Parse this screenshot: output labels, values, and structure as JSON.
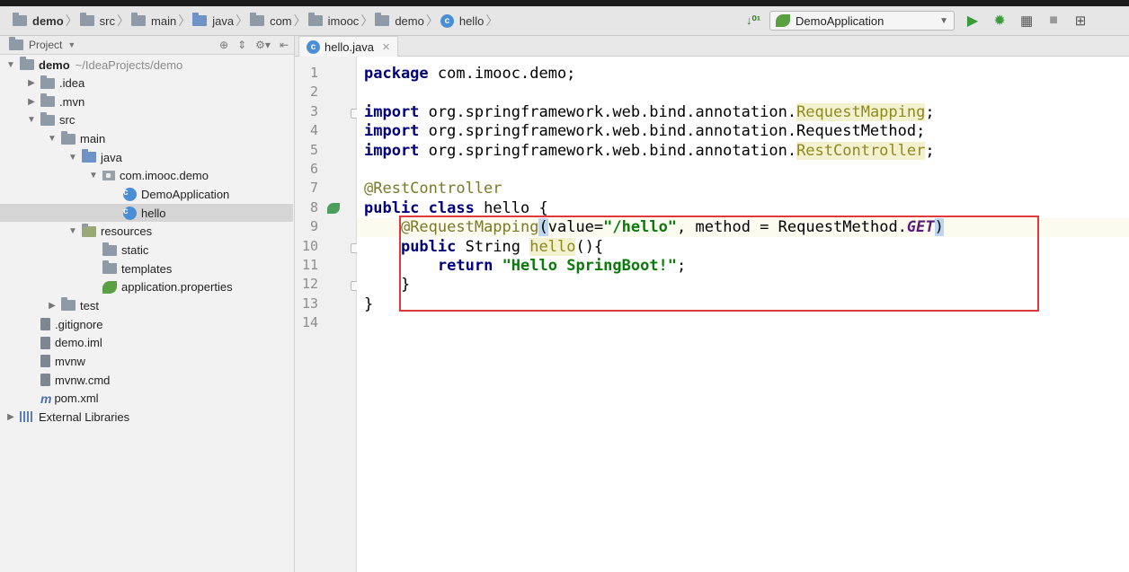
{
  "breadcrumb": [
    "demo",
    "src",
    "main",
    "java",
    "com",
    "imooc",
    "demo",
    "hello"
  ],
  "run_config": {
    "selected": "DemoApplication"
  },
  "project_panel": {
    "title": "Project",
    "tree": [
      {
        "label": "demo",
        "suffix": "~/IdeaProjects/demo",
        "icon": "module-folder-icon",
        "level": 0,
        "expanded": true
      },
      {
        "label": ".idea",
        "icon": "folder-icon",
        "level": 1,
        "expanded": false
      },
      {
        "label": ".mvn",
        "icon": "folder-icon",
        "level": 1,
        "expanded": false
      },
      {
        "label": "src",
        "icon": "folder-icon",
        "level": 1,
        "expanded": true
      },
      {
        "label": "main",
        "icon": "folder-icon",
        "level": 2,
        "expanded": true
      },
      {
        "label": "java",
        "icon": "source-folder-icon",
        "level": 3,
        "expanded": true
      },
      {
        "label": "com.imooc.demo",
        "icon": "package-icon",
        "level": 4,
        "expanded": true
      },
      {
        "label": "DemoApplication",
        "icon": "spring-class-icon",
        "level": 5
      },
      {
        "label": "hello",
        "icon": "class-icon",
        "level": 5,
        "selected": true
      },
      {
        "label": "resources",
        "icon": "resources-folder-icon",
        "level": 3,
        "expanded": true
      },
      {
        "label": "static",
        "icon": "folder-icon",
        "level": 4
      },
      {
        "label": "templates",
        "icon": "folder-icon",
        "level": 4
      },
      {
        "label": "application.properties",
        "icon": "spring-properties-icon",
        "level": 4
      },
      {
        "label": "test",
        "icon": "folder-icon",
        "level": 2,
        "expanded": false
      },
      {
        "label": ".gitignore",
        "icon": "file-icon",
        "level": 1
      },
      {
        "label": "demo.iml",
        "icon": "file-icon",
        "level": 1
      },
      {
        "label": "mvnw",
        "icon": "file-icon",
        "level": 1
      },
      {
        "label": "mvnw.cmd",
        "icon": "file-icon",
        "level": 1
      },
      {
        "label": "pom.xml",
        "icon": "maven-icon",
        "level": 1
      },
      {
        "label": "External Libraries",
        "icon": "libraries-icon",
        "level": 0,
        "expanded": false
      }
    ]
  },
  "editor": {
    "tab": "hello.java",
    "line_numbers": [
      "1",
      "2",
      "3",
      "4",
      "5",
      "6",
      "7",
      "8",
      "9",
      "10",
      "11",
      "12",
      "13",
      "14"
    ],
    "code": [
      [
        {
          "t": "package",
          "c": "kw"
        },
        {
          "t": " com.imooc.demo;"
        }
      ],
      [],
      [
        {
          "t": "import",
          "c": "kw"
        },
        {
          "t": " org.springframework.web.bind.annotation."
        },
        {
          "t": "RequestMapping",
          "c": "unres"
        },
        {
          "t": ";"
        }
      ],
      [
        {
          "t": "import",
          "c": "kw"
        },
        {
          "t": " org.springframework.web.bind.annotation.RequestMethod;"
        }
      ],
      [
        {
          "t": "import",
          "c": "kw"
        },
        {
          "t": " org.springframework.web.bind.annotation."
        },
        {
          "t": "RestController",
          "c": "unres"
        },
        {
          "t": ";"
        }
      ],
      [],
      [
        {
          "t": "@RestController",
          "c": "ann"
        }
      ],
      [
        {
          "t": "public class",
          "c": "kw"
        },
        {
          "t": " hello {"
        }
      ],
      [
        {
          "t": "    "
        },
        {
          "t": "@RequestMapping",
          "c": "ann"
        },
        {
          "t": "(",
          "c": "paren"
        },
        {
          "t": "value="
        },
        {
          "t": "\"/hello\"",
          "c": "str"
        },
        {
          "t": ", method = RequestMethod."
        },
        {
          "t": "GET",
          "c": "fld"
        },
        {
          "t": ")",
          "c": "paren"
        }
      ],
      [
        {
          "t": "    "
        },
        {
          "t": "public",
          "c": "kw"
        },
        {
          "t": " String "
        },
        {
          "t": "hello",
          "c": "unres"
        },
        {
          "t": "(){"
        }
      ],
      [
        {
          "t": "        "
        },
        {
          "t": "return",
          "c": "kw"
        },
        {
          "t": " "
        },
        {
          "t": "\"Hello SpringBoot!\"",
          "c": "str"
        },
        {
          "t": ";"
        }
      ],
      [
        {
          "t": "    }"
        }
      ],
      [
        {
          "t": "}"
        }
      ],
      []
    ]
  },
  "colors": {
    "callout_border": "#e0393b",
    "keyword": "#00007f",
    "string": "#0a7a0a"
  }
}
